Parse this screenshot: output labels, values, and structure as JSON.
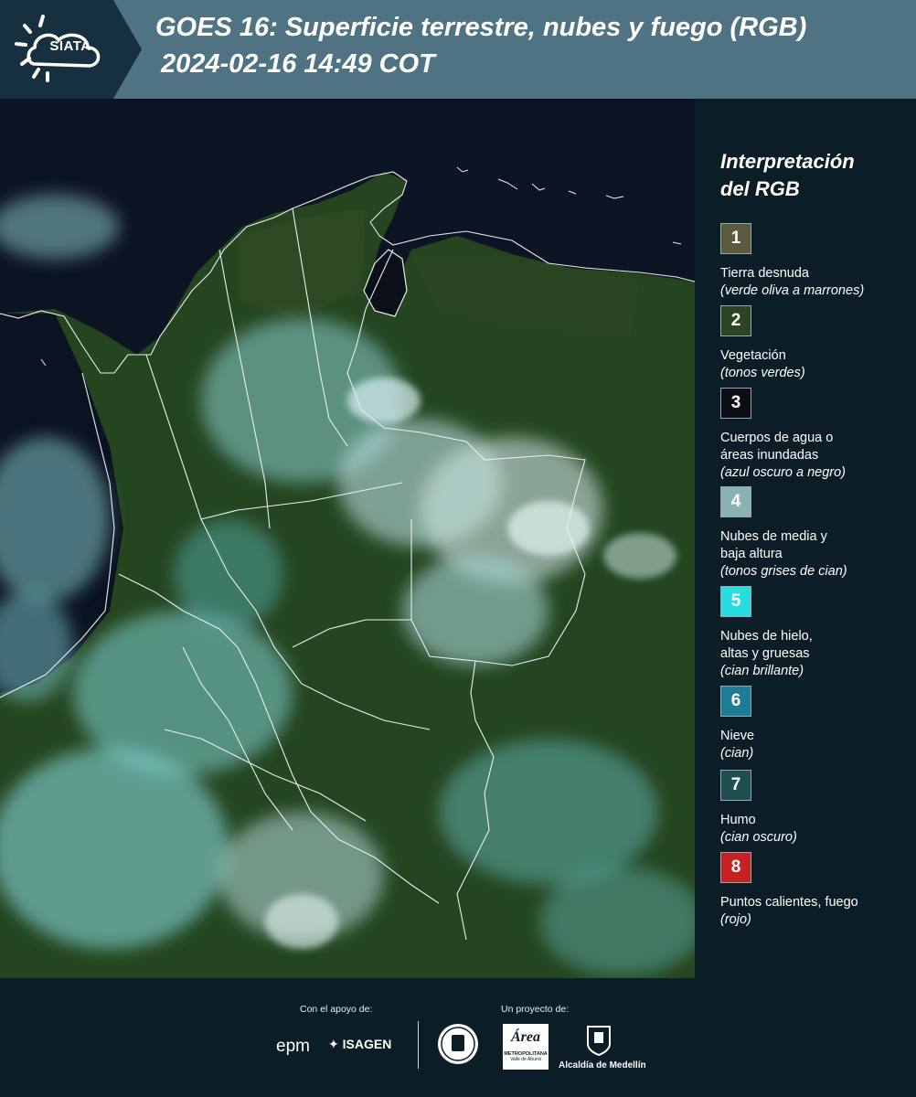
{
  "header": {
    "logo_text": "SIATA",
    "title_line1": "GOES 16: Superficie terrestre, nubes y fuego (RGB)",
    "title_line2": "2024-02-16 14:49 COT"
  },
  "map": {
    "icon": "satellite-rgb-map"
  },
  "legend": {
    "title_line1": "Interpretación",
    "title_line2": "del RGB",
    "items": [
      {
        "num": "1",
        "color": "#5b5a3f",
        "label1": "Tierra desnuda",
        "label2": "",
        "note": "(verde oliva a marrones)"
      },
      {
        "num": "2",
        "color": "#2c4423",
        "label1": "Vegetación",
        "label2": "",
        "note": "(tonos verdes)"
      },
      {
        "num": "3",
        "color": "#0b0f14",
        "label1": "Cuerpos de agua o",
        "label2": "áreas inundadas",
        "note": "(azul oscuro a negro)"
      },
      {
        "num": "4",
        "color": "#8ab1b4",
        "label1": "Nubes de media y",
        "label2": "baja altura",
        "note": "(tonos grises de cian)"
      },
      {
        "num": "5",
        "color": "#27dde0",
        "label1": "Nubes de hielo,",
        "label2": "altas y gruesas",
        "note": "(cian brillante)"
      },
      {
        "num": "6",
        "color": "#1e7d96",
        "label1": "Nieve",
        "label2": "",
        "note": "(cian)"
      },
      {
        "num": "7",
        "color": "#1f4f52",
        "label1": "Humo",
        "label2": "",
        "note": "(cian oscuro)"
      },
      {
        "num": "8",
        "color": "#c62222",
        "label1": "Puntos calientes, fuego",
        "label2": "",
        "note": "(rojo)"
      }
    ]
  },
  "footer": {
    "support_label": "Con el apoyo de:",
    "project_label": "Un proyecto de:",
    "sponsor_epm": "epm",
    "sponsor_isagen": "ISAGEN",
    "sponsor_area": "Área",
    "sponsor_area_sub1": "METROPOLITANA",
    "sponsor_area_sub2": "Valle de Aburrá",
    "sponsor_alcaldia": "Alcaldía de Medellín"
  }
}
